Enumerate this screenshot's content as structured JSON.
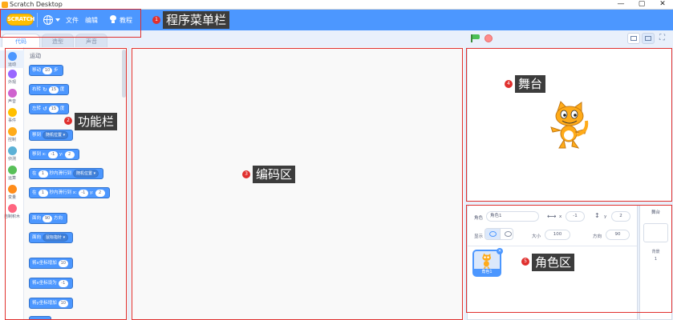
{
  "window": {
    "title": "Scratch Desktop",
    "controls": [
      "—",
      "▢",
      "✕"
    ]
  },
  "menubar": {
    "logo_text": "SCRATCH",
    "items": [
      "文件",
      "编辑",
      "教程"
    ],
    "accent": "#4c97ff"
  },
  "tabs": [
    "代码",
    "造型",
    "声音"
  ],
  "categories": [
    {
      "label": "运动",
      "color": "#4c97ff"
    },
    {
      "label": "外观",
      "color": "#9966ff"
    },
    {
      "label": "声音",
      "color": "#cf63cf"
    },
    {
      "label": "事件",
      "color": "#ffbf00"
    },
    {
      "label": "控制",
      "color": "#ffab19"
    },
    {
      "label": "侦测",
      "color": "#5cb1d6"
    },
    {
      "label": "运算",
      "color": "#59c059"
    },
    {
      "label": "变量",
      "color": "#ff8c1a"
    },
    {
      "label": "自制积木",
      "color": "#ff6680"
    }
  ],
  "palette": {
    "title": "运动",
    "blocks": {
      "move": {
        "t1": "移动",
        "n1": "10",
        "t2": "步"
      },
      "turn_right": {
        "t1": "右转",
        "n1": "15",
        "t2": "度"
      },
      "turn_left": {
        "t1": "左转",
        "n1": "15",
        "t2": "度"
      },
      "goto": {
        "t1": "移到",
        "d1": "随机位置 ▾"
      },
      "goto_xy": {
        "t1": "移到 x:",
        "n1": "-1",
        "t2": "y:",
        "n2": "2"
      },
      "glide": {
        "t1": "在",
        "n1": "1",
        "t2": "秒内滑行到",
        "d1": "随机位置 ▾"
      },
      "glide_xy": {
        "t1": "在",
        "n1": "1",
        "t2": "秒内滑行到 x:",
        "n2": "-1",
        "t3": "y:",
        "n3": "2"
      },
      "point_dir": {
        "t1": "面向",
        "n1": "90",
        "t2": "方向"
      },
      "point_towards": {
        "t1": "面向",
        "d1": "鼠标指针 ▾"
      },
      "change_x": {
        "t1": "将x坐标增加",
        "n1": "10"
      },
      "set_x": {
        "t1": "将x坐标设为",
        "n1": "-1"
      },
      "change_y": {
        "t1": "将y坐标增加",
        "n1": "10"
      }
    }
  },
  "sprite_info": {
    "sprite_label": "角色",
    "sprite_name": "角色1",
    "x_label": "x",
    "x_value": "-1",
    "y_label": "y",
    "y_value": "2",
    "show_label": "显示",
    "size_label": "大小",
    "size_value": "100",
    "direction_label": "方向",
    "direction_value": "90",
    "thumb_name": "角色1"
  },
  "stage_selector": {
    "title": "舞台",
    "backdrops_label": "背景",
    "backdrops_count": "1"
  },
  "annotations": [
    {
      "num": "1",
      "label": "程序菜单栏"
    },
    {
      "num": "2",
      "label": "功能栏"
    },
    {
      "num": "3",
      "label": "编码区"
    },
    {
      "num": "4",
      "label": "舞台"
    },
    {
      "num": "5",
      "label": "角色区"
    }
  ],
  "colors": {
    "annotation_red": "#e0302e",
    "motion_blue": "#4c97ff",
    "label_bg": "#3c3c3c"
  }
}
